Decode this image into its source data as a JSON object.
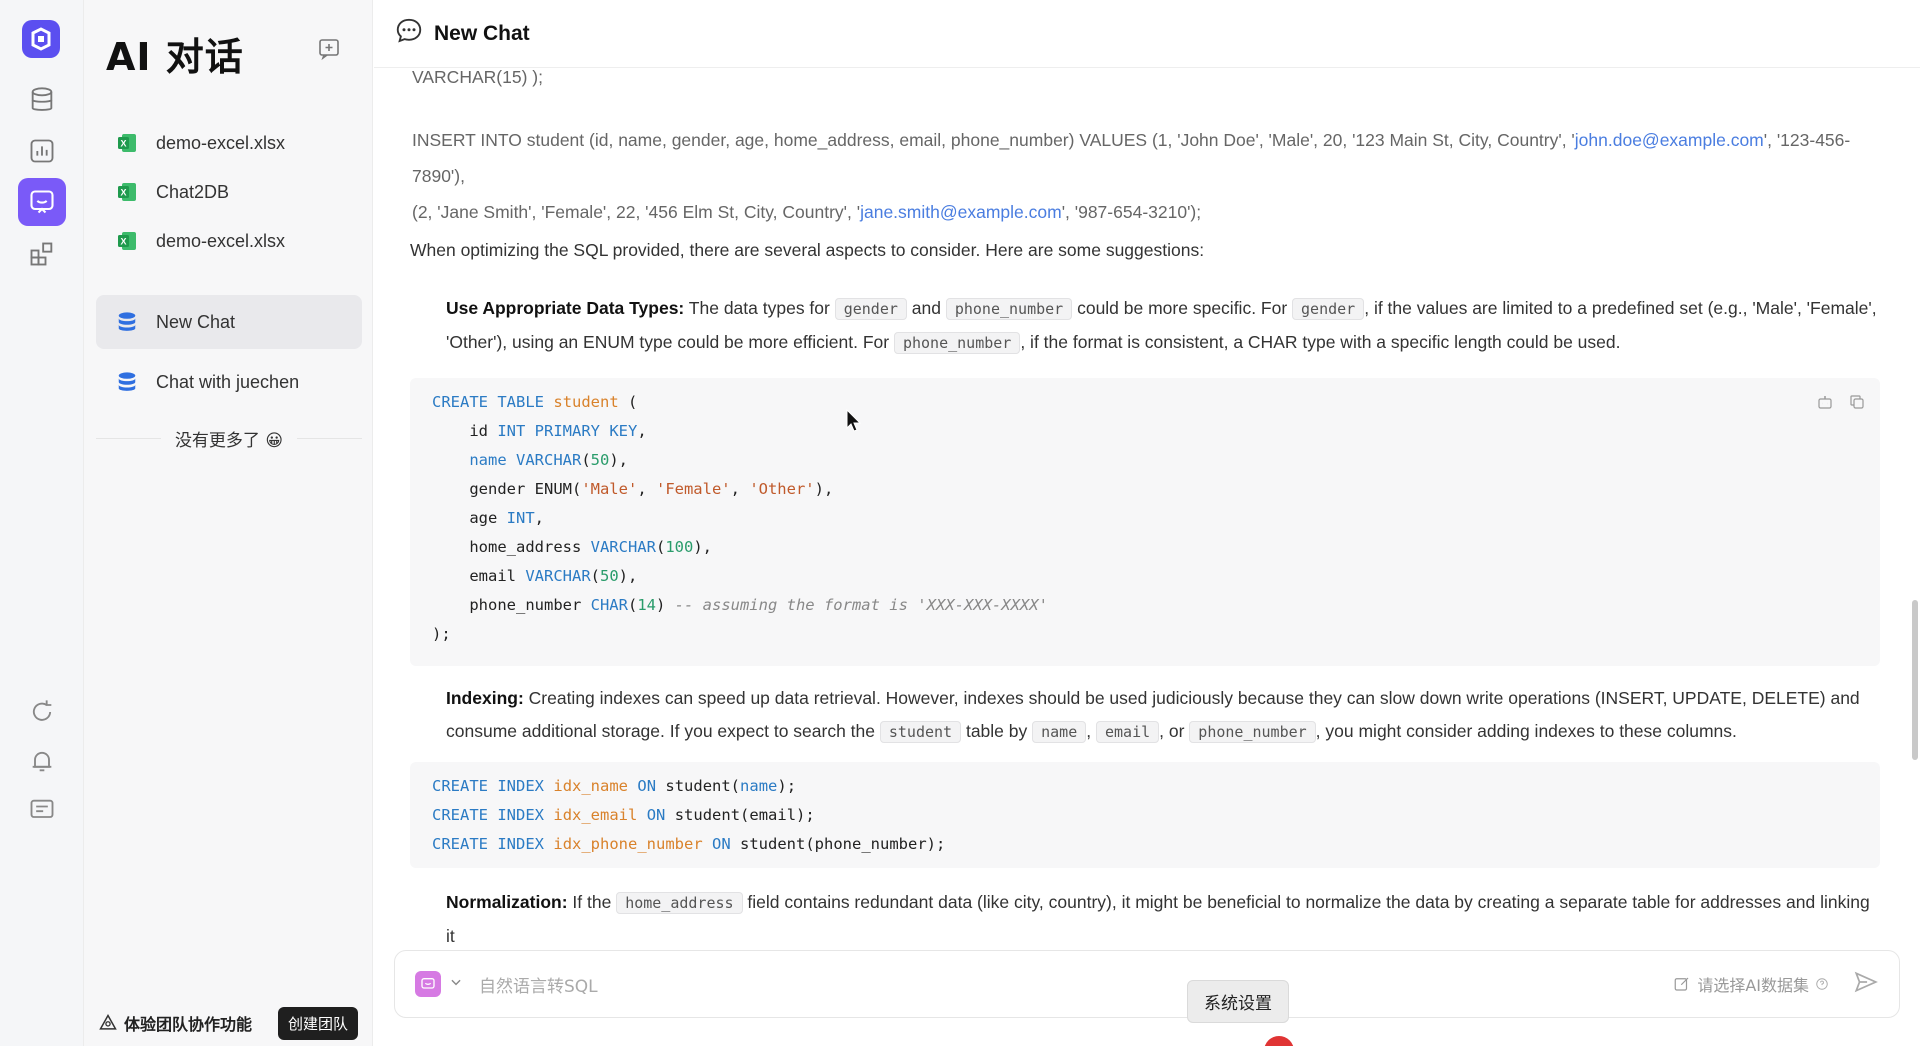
{
  "rail": {
    "icons": [
      "logo-icon",
      "database-icon",
      "chart-icon",
      "chat-icon",
      "grid-icon",
      "refresh-icon",
      "bell-icon",
      "feedback-icon"
    ]
  },
  "sidebar": {
    "title": "AI 对话",
    "items": [
      {
        "label": "demo-excel.xlsx",
        "icon": "excel-icon"
      },
      {
        "label": "Chat2DB",
        "icon": "excel-icon"
      },
      {
        "label": "demo-excel.xlsx",
        "icon": "excel-icon"
      },
      {
        "label": "New Chat",
        "icon": "database-icon"
      },
      {
        "label": "Chat with juechen",
        "icon": "database-icon"
      }
    ],
    "no_more": "没有更多了 😀",
    "team_label": "体验团队协作功能",
    "create_team": "创建团队"
  },
  "header": {
    "title": "New Chat"
  },
  "content": {
    "line1": "VARCHAR(15) );",
    "insert_a": "INSERT INTO student (id, name, gender, age, home_address, email, phone_number) VALUES (1, 'John Doe', 'Male', 20, '123 Main St, City, Country', '",
    "insert_email1": "john.doe@example.com",
    "insert_b": "', '123-456-7890'),",
    "insert_c": "(2, 'Jane Smith', 'Female', 22, '456 Elm St, City, Country', '",
    "insert_email2": "jane.smith@example.com",
    "insert_d": "', '987-654-3210');",
    "intro": "When optimizing the SQL provided, there are several aspects to consider. Here are some suggestions:",
    "p1_title": "Use Appropriate Data Types:",
    "p1_a": " The data types for ",
    "p1_code1": "gender",
    "p1_b": " and ",
    "p1_code2": "phone_number",
    "p1_c": " could be more specific. For ",
    "p1_code3": "gender",
    "p1_d": ", if the values are limited to a predefined set (e.g., 'Male', 'Female', 'Other'), using an ENUM type could be more efficient. For ",
    "p1_code4": "phone_number",
    "p1_e": ", if the format is consistent, a CHAR type with a specific length could be used.",
    "p2_title": "Indexing:",
    "p2_a": " Creating indexes can speed up data retrieval. However, indexes should be used judiciously because they can slow down write operations (INSERT, UPDATE, DELETE) and consume additional storage. If you expect to search the ",
    "p2_code1": "student",
    "p2_b": " table by ",
    "p2_code2": "name",
    "p2_c": ", ",
    "p2_code3": "email",
    "p2_d": ", or ",
    "p2_code4": "phone_number",
    "p2_e": ", you might consider adding indexes to these columns.",
    "p3_title": "Normalization:",
    "p3_a": " If the ",
    "p3_code1": "home_address",
    "p3_b": " field contains redundant data (like city, country), it might be beneficial to normalize the data by creating a separate table for addresses and linking it"
  },
  "input": {
    "placeholder": "自然语言转SQL",
    "datasource": "请选择AI数据集"
  },
  "tooltip": "系统设置"
}
